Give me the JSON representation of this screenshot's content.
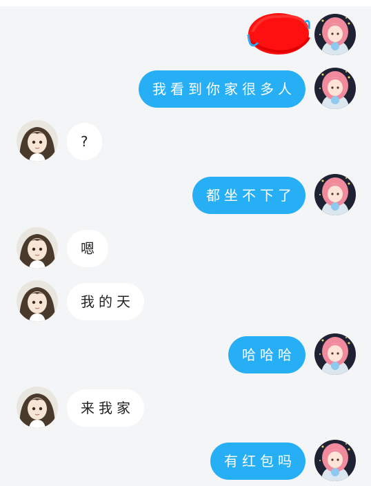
{
  "colors": {
    "background": "#f4f5f7",
    "outgoing_bubble": "#27aff5",
    "incoming_bubble": "#ffffff",
    "redaction": "#ff1010"
  },
  "messages": [
    {
      "side": "out",
      "text": "",
      "redacted": true
    },
    {
      "side": "out",
      "text": "我看到你家很多人"
    },
    {
      "side": "in",
      "text": "?"
    },
    {
      "side": "out",
      "text": "都坐不下了"
    },
    {
      "side": "in",
      "text": "嗯"
    },
    {
      "side": "in",
      "text": "我的天"
    },
    {
      "side": "out",
      "text": "哈哈哈"
    },
    {
      "side": "in",
      "text": "来我家"
    },
    {
      "side": "out",
      "text": "有红包吗"
    }
  ]
}
